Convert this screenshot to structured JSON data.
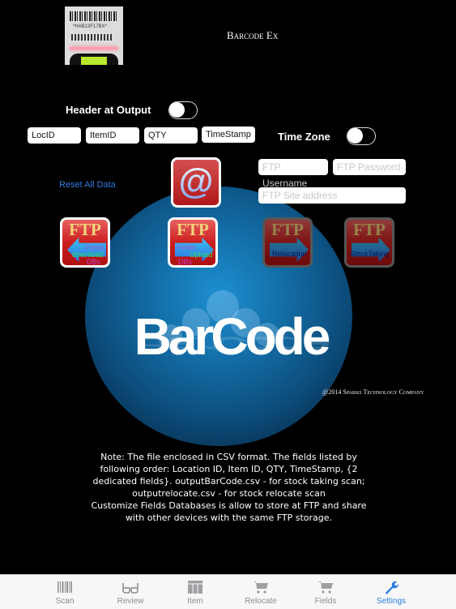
{
  "header": {
    "title": "Barcode Ex",
    "thumbnail": {
      "barcode_text": "*HAB13F17BX*"
    }
  },
  "settings": {
    "header_output_label": "Header at  Output",
    "header_output_on": false,
    "time_zone_label": "Time  Zone",
    "time_zone_on": false,
    "fields": [
      "LocID",
      "ItemID",
      "QTY",
      "TimeStamp"
    ],
    "reset_label": "Reset All Data",
    "email_icon": "@",
    "ftp_username_placeholder": "FTP Username",
    "ftp_password_placeholder": "FTP Password",
    "ftp_site_placeholder": "FTP Site address"
  },
  "ftp_buttons": [
    {
      "title": "FTP",
      "lines": [
        "Fields",
        "download",
        "DBs"
      ],
      "enabled": true
    },
    {
      "title": "FTP",
      "lines": [
        "Fields",
        "Upload",
        "DBs"
      ],
      "enabled": true
    },
    {
      "title": "FTP",
      "lines": [
        "Relocation"
      ],
      "enabled": false
    },
    {
      "title": "FTP",
      "lines": [
        "StockTaking"
      ],
      "enabled": false
    }
  ],
  "splash": {
    "logo": "BarCode",
    "copyright": "@2014 Sparks Technology Company"
  },
  "note": [
    "Note: The file enclosed in CSV format.  The fields listed by",
    "following order: Location ID, Item ID, QTY, TimeStamp, {2",
    "dedicated fields}. outputBarCode.csv - for stock taking scan;",
    "outputrelocate.csv - for stock relocate scan",
    "Customize Fields Databases is allow to store at FTP and share",
    "with other devices with the same FTP storage."
  ],
  "tabbar": {
    "active": "Settings",
    "active_color": "#2a7ee0",
    "items": [
      {
        "label": "Scan",
        "icon": "barcode-icon"
      },
      {
        "label": "Review",
        "icon": "glasses-icon"
      },
      {
        "label": "Item",
        "icon": "table-icon"
      },
      {
        "label": "Relocate",
        "icon": "cart-icon"
      },
      {
        "label": "Fields",
        "icon": "cart-icon"
      },
      {
        "label": "Settings",
        "icon": "wrench-icon"
      }
    ]
  }
}
